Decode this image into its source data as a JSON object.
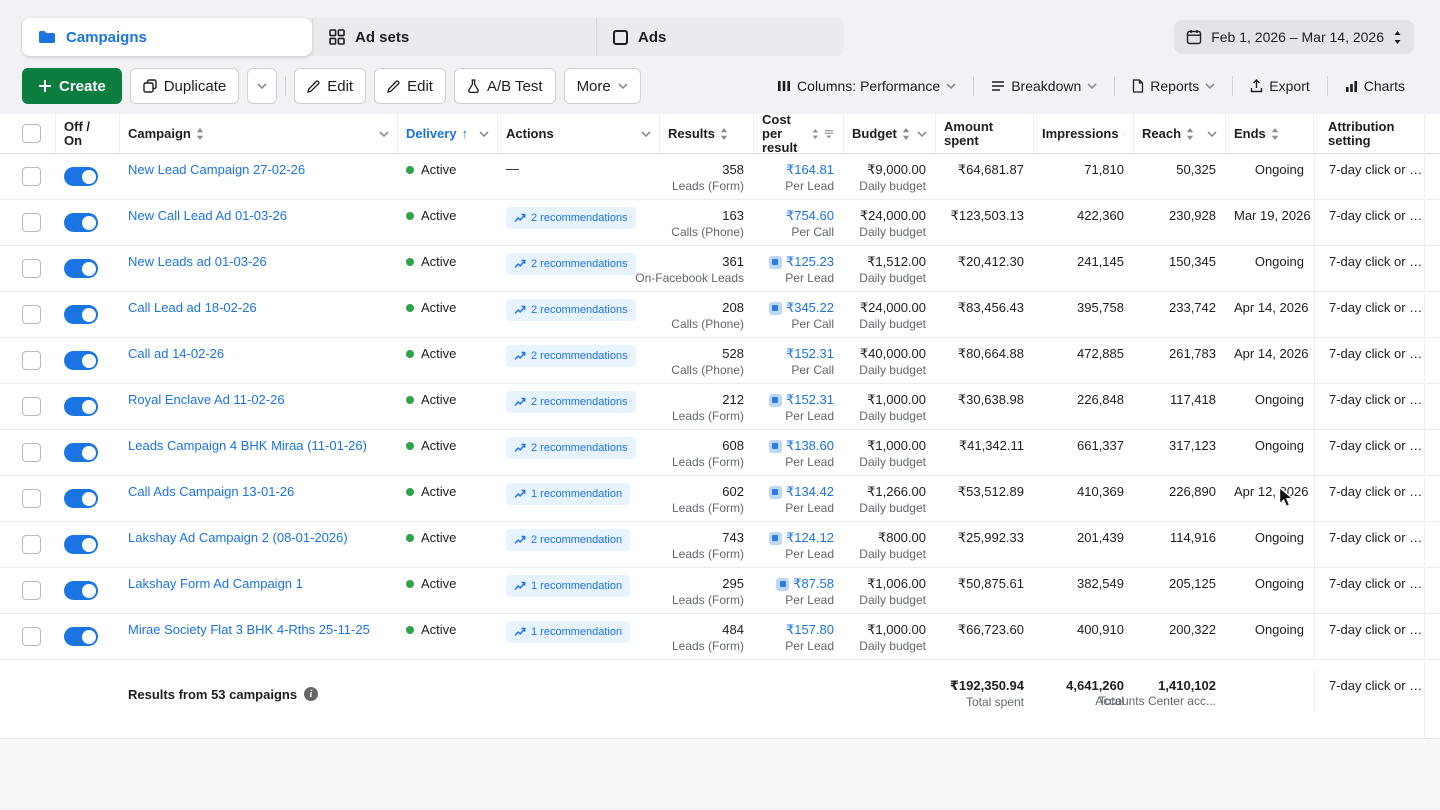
{
  "tabs": {
    "campaigns": "Campaigns",
    "ad_sets": "Ad sets",
    "ads": "Ads"
  },
  "date_range": "Feb 1, 2026 – Mar 14, 2026",
  "toolbar": {
    "create": "Create",
    "duplicate": "Duplicate",
    "edit_a": "Edit",
    "edit_b": "Edit",
    "ab_test": "A/B Test",
    "more": "More",
    "columns": "Columns: Performance",
    "breakdown": "Breakdown",
    "reports": "Reports",
    "export": "Export",
    "charts": "Charts"
  },
  "icons": {
    "campaigns": "folder-icon",
    "ad_sets": "grid-icon",
    "ads": "square-icon",
    "date": "calendar-icon",
    "create": "plus-icon",
    "duplicate": "copy-icon",
    "edit": "pencil-icon",
    "ab_test": "flask-icon",
    "columns": "column-bars-icon",
    "breakdown": "rows-icon",
    "reports": "document-icon",
    "export": "export-arrow-icon",
    "charts": "bar-chart-icon",
    "sort": "sort-arrows-icon",
    "delivery_sort": "arrow-up-icon",
    "recommendation": "trending-up-icon",
    "cost_goal": "cost-goal-icon",
    "info": "info-icon",
    "cursor": "mouse-cursor"
  },
  "colors": {
    "link_blue": "#1b74e4",
    "create_green": "#0b7d3e",
    "active_dot_green": "#31a24c",
    "pill_bg": "#e7f3ff",
    "page_bg": "#f0f2f5"
  },
  "table": {
    "headers": {
      "off_on": "Off / On",
      "campaign": "Campaign",
      "delivery": "Delivery",
      "actions": "Actions",
      "results": "Results",
      "cost_per_result": "Cost per result",
      "budget": "Budget",
      "amount_spent": "Amount spent",
      "impressions": "Impressions",
      "reach": "Reach",
      "ends": "Ends",
      "attribution": "Attribution setting"
    },
    "rows": [
      {
        "name": "New Lead Campaign 27-02-26",
        "delivery": "Active",
        "dash": "—",
        "recommendation": null,
        "results": "358",
        "results_label": "Leads (Form)",
        "cost": "₹164.81",
        "cost_label": "Per Lead",
        "cost_icon": false,
        "budget": "₹9,000.00",
        "budget_label": "Daily budget",
        "spent": "₹64,681.87",
        "impressions": "71,810",
        "reach": "50,325",
        "ends": "Ongoing",
        "attribution": "7-day click or …"
      },
      {
        "name": "New Call Lead Ad 01-03-26",
        "delivery": "Active",
        "dash": "",
        "recommendation": "2 recommendations",
        "results": "163",
        "results_label": "Calls (Phone)",
        "cost": "₹754.60",
        "cost_label": "Per Call",
        "cost_icon": false,
        "budget": "₹24,000.00",
        "budget_label": "Daily budget",
        "spent": "₹123,503.13",
        "impressions": "422,360",
        "reach": "230,928",
        "ends": "Mar 19, 2026",
        "attribution": "7-day click or …"
      },
      {
        "name": "New Leads ad 01-03-26",
        "delivery": "Active",
        "dash": "",
        "recommendation": "2 recommendations",
        "results": "361",
        "results_label": "On-Facebook Leads",
        "cost": "₹125.23",
        "cost_label": "Per Lead",
        "cost_icon": true,
        "budget": "₹1,512.00",
        "budget_label": "Daily budget",
        "spent": "₹20,412.30",
        "impressions": "241,145",
        "reach": "150,345",
        "ends": "Ongoing",
        "attribution": "7-day click or …"
      },
      {
        "name": "Call Lead ad 18-02-26",
        "delivery": "Active",
        "dash": "",
        "recommendation": "2 recommendations",
        "results": "208",
        "results_label": "Calls (Phone)",
        "cost": "₹345.22",
        "cost_label": "Per Call",
        "cost_icon": true,
        "budget": "₹24,000.00",
        "budget_label": "Daily budget",
        "spent": "₹83,456.43",
        "impressions": "395,758",
        "reach": "233,742",
        "ends": "Apr 14, 2026",
        "attribution": "7-day click or …"
      },
      {
        "name": "Call ad 14-02-26",
        "delivery": "Active",
        "dash": "",
        "recommendation": "2 recommendations",
        "results": "528",
        "results_label": "Calls (Phone)",
        "cost": "₹152.31",
        "cost_label": "Per Call",
        "cost_icon": false,
        "budget": "₹40,000.00",
        "budget_label": "Daily budget",
        "spent": "₹80,664.88",
        "impressions": "472,885",
        "reach": "261,783",
        "ends": "Apr 14, 2026",
        "attribution": "7-day click or …"
      },
      {
        "name": "Royal Enclave Ad 11-02-26",
        "delivery": "Active",
        "dash": "",
        "recommendation": "2 recommendations",
        "results": "212",
        "results_label": "Leads (Form)",
        "cost": "₹152.31",
        "cost_label": "Per Lead",
        "cost_icon": true,
        "budget": "₹1,000.00",
        "budget_label": "Daily budget",
        "spent": "₹30,638.98",
        "impressions": "226,848",
        "reach": "117,418",
        "ends": "Ongoing",
        "attribution": "7-day click or …"
      },
      {
        "name": "Leads Campaign 4 BHK Miraa (11-01-26)",
        "delivery": "Active",
        "dash": "",
        "recommendation": "2 recommendations",
        "results": "608",
        "results_label": "Leads (Form)",
        "cost": "₹138.60",
        "cost_label": "Per Lead",
        "cost_icon": true,
        "budget": "₹1,000.00",
        "budget_label": "Daily budget",
        "spent": "₹41,342.11",
        "impressions": "661,337",
        "reach": "317,123",
        "ends": "Ongoing",
        "attribution": "7-day click or …"
      },
      {
        "name": "Call Ads Campaign 13-01-26",
        "delivery": "Active",
        "dash": "",
        "recommendation": "1 recommendation",
        "results": "602",
        "results_label": "Leads (Form)",
        "cost": "₹134.42",
        "cost_label": "Per Lead",
        "cost_icon": true,
        "budget": "₹1,266.00",
        "budget_label": "Daily budget",
        "spent": "₹53,512.89",
        "impressions": "410,369",
        "reach": "226,890",
        "ends": "Apr 12, 2026",
        "attribution": "7-day click or …"
      },
      {
        "name": "Lakshay Ad Campaign 2 (08-01-2026)",
        "delivery": "Active",
        "dash": "",
        "recommendation": "2 recommendation",
        "results": "743",
        "results_label": "Leads (Form)",
        "cost": "₹124.12",
        "cost_label": "Per Lead",
        "cost_icon": true,
        "budget": "₹800.00",
        "budget_label": "Daily budget",
        "spent": "₹25,992.33",
        "impressions": "201,439",
        "reach": "114,916",
        "ends": "Ongoing",
        "attribution": "7-day click or …"
      },
      {
        "name": "Lakshay Form Ad Campaign 1",
        "delivery": "Active",
        "dash": "",
        "recommendation": "1 recommendation",
        "results": "295",
        "results_label": "Leads (Form)",
        "cost": "₹87.58",
        "cost_label": "Per Lead",
        "cost_icon": true,
        "budget": "₹1,006.00",
        "budget_label": "Daily budget",
        "spent": "₹50,875.61",
        "impressions": "382,549",
        "reach": "205,125",
        "ends": "Ongoing",
        "attribution": "7-day click or …"
      },
      {
        "name": "Mirae Society Flat 3 BHK 4-Rths 25-11-25",
        "delivery": "Active",
        "dash": "",
        "recommendation": "1 recommendation",
        "results": "484",
        "results_label": "Leads (Form)",
        "cost": "₹157.80",
        "cost_label": "Per Lead",
        "cost_icon": false,
        "budget": "₹1,000.00",
        "budget_label": "Daily budget",
        "spent": "₹66,723.60",
        "impressions": "400,910",
        "reach": "200,322",
        "ends": "Ongoing",
        "attribution": "7-day click or …"
      }
    ],
    "footer": {
      "summary": "Results from 53 campaigns",
      "total_spent": "₹192,350.94",
      "total_spent_label": "Total spent",
      "impressions_total": "4,641,260",
      "impressions_label": "Total",
      "reach_total": "1,410,102",
      "reach_label": "Accounts Center acc...",
      "attribution": "7-day click or …"
    }
  }
}
